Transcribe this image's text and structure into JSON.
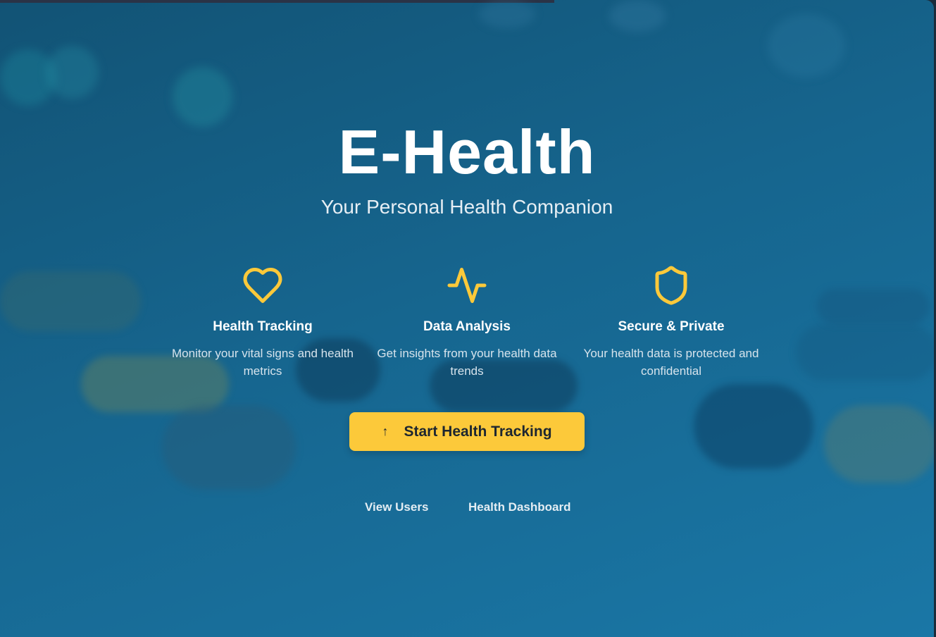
{
  "app": {
    "title": "E-Health",
    "subtitle": "Your Personal Health Companion"
  },
  "features": [
    {
      "icon": "heart-icon",
      "title": "Health Tracking",
      "description": "Monitor your vital signs and health metrics"
    },
    {
      "icon": "activity-pulse-icon",
      "title": "Data Analysis",
      "description": "Get insights from your health data trends"
    },
    {
      "icon": "shield-icon",
      "title": "Secure & Private",
      "description": "Your health data is protected and confidential"
    }
  ],
  "cta": {
    "icon": "arrow-up-icon",
    "label": "Start Health Tracking"
  },
  "links": {
    "view_users": "View Users",
    "health_dashboard": "Health Dashboard"
  },
  "colors": {
    "accent": "#fcc93a",
    "background": "#16658e",
    "text": "#ffffff"
  }
}
